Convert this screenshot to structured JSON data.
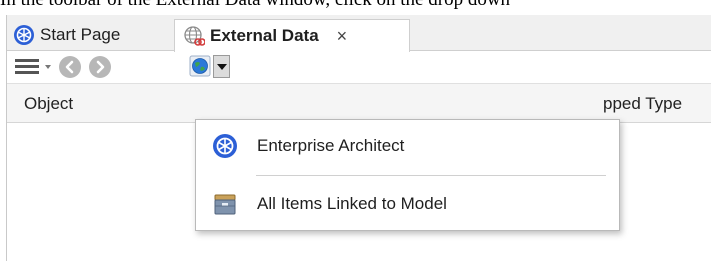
{
  "caption": "In the toolbar of the External Data window, click on the drop down",
  "tabs": [
    {
      "label": "Start Page",
      "icon": "enterprise-architect-icon"
    },
    {
      "label": "External Data",
      "icon": "linked-globe-icon",
      "close": "×"
    }
  ],
  "toolbar": {
    "menu_icon": "hamburger-menu-icon",
    "back_icon": "back-arrow-icon",
    "forward_icon": "forward-arrow-icon",
    "globe_icon": "globe-icon",
    "dropdown_icon": "dropdown-arrow-icon"
  },
  "columns": {
    "object": "Object",
    "mapped_type": "pped Type"
  },
  "menu": {
    "items": [
      {
        "label": "Enterprise Architect",
        "icon": "enterprise-architect-icon"
      },
      {
        "label": "All Items Linked to Model",
        "icon": "linked-items-box-icon"
      }
    ]
  },
  "colors": {
    "ea_blue": "#2c5fd6",
    "tab_bar": "#f0f0f0",
    "nav_gray": "#b7b7b7"
  }
}
